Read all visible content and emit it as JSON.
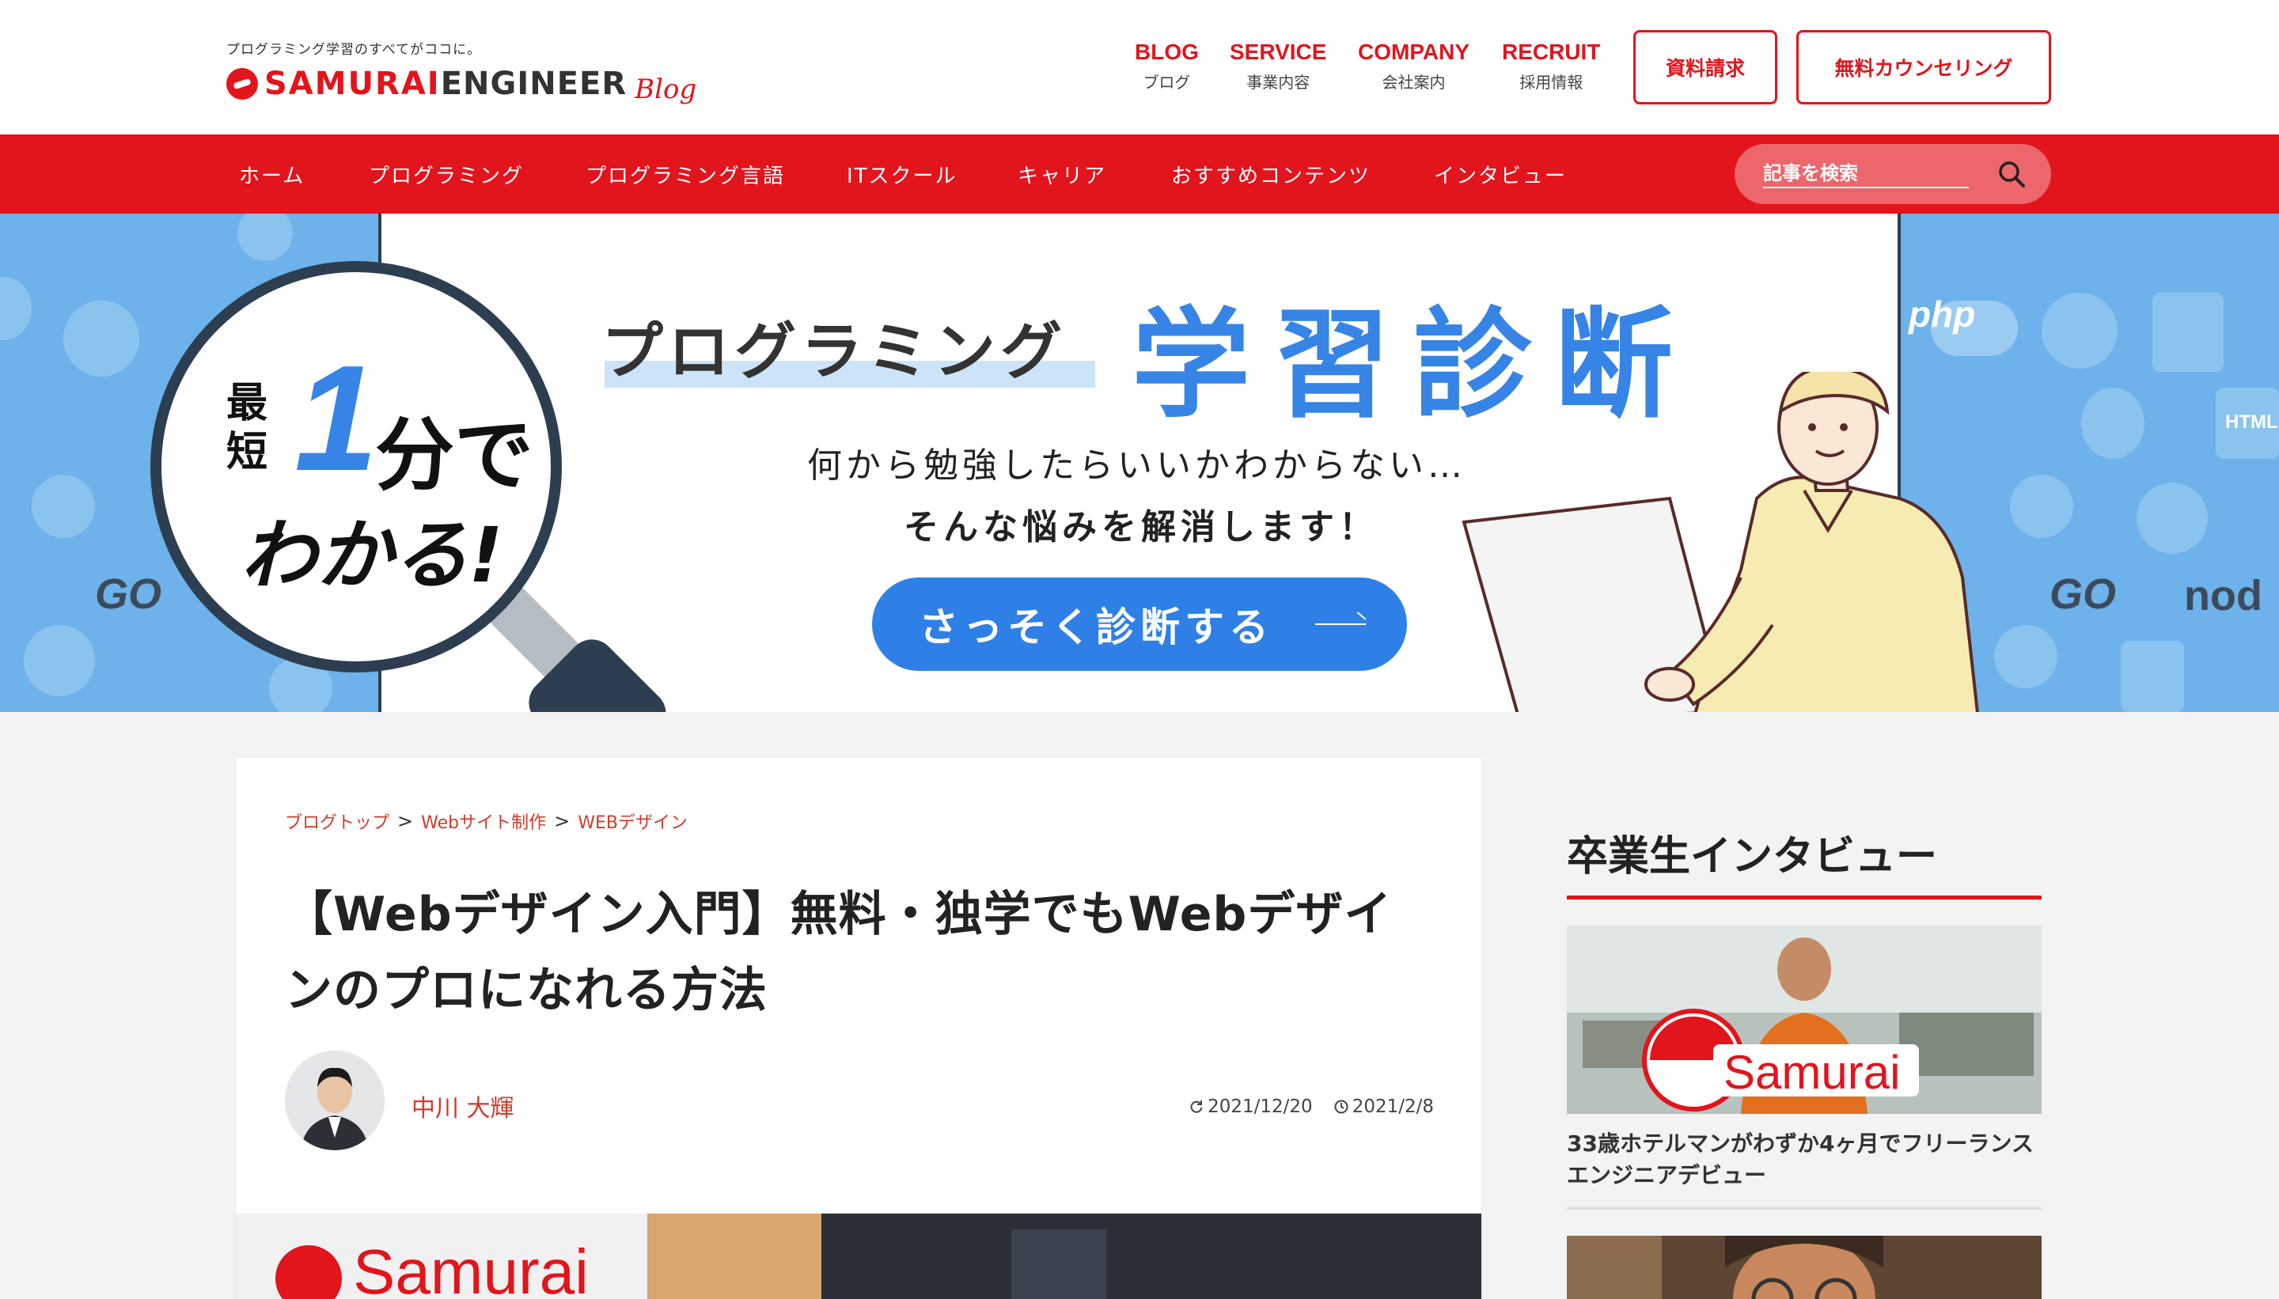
{
  "header": {
    "tagline": "プログラミング学習のすべてがココに。",
    "logo_samurai": "SAMURAI",
    "logo_engineer": "ENGINEER",
    "logo_blog": "Blog",
    "nav": [
      {
        "en": "BLOG",
        "jp": "ブログ"
      },
      {
        "en": "SERVICE",
        "jp": "事業内容"
      },
      {
        "en": "COMPANY",
        "jp": "会社案内"
      },
      {
        "en": "RECRUIT",
        "jp": "採用情報"
      }
    ],
    "request_button": "資料請求",
    "counseling_button": "無料カウンセリング"
  },
  "navbar": {
    "items": [
      "ホーム",
      "プログラミング",
      "プログラミング言語",
      "ITスクール",
      "キャリア",
      "おすすめコンテンツ",
      "インタビュー"
    ],
    "search_placeholder": "記事を検索"
  },
  "banner": {
    "saitan": "最短",
    "one": "1",
    "fun_de": "分で",
    "wakaru": "わかる!",
    "programming": "プログラミング",
    "shindan": "学習診断",
    "sub1": "何から勉強したらいいかわからない…",
    "sub2": "そんな悩みを解消します！",
    "cta": "さっそく診断する",
    "icon_labels": [
      "php",
      "GO",
      "HTML",
      "nod"
    ]
  },
  "article": {
    "breadcrumbs": [
      "ブログトップ",
      "Webサイト制作",
      "WEBデザイン"
    ],
    "separator": ">",
    "title": "【Webデザイン入門】無料・独学でもWebデザインのプロになれる方法",
    "author": "中川 大輝",
    "updated": "2021/12/20",
    "published": "2021/2/8",
    "eyecatch_logo": "Samurai"
  },
  "sidebar": {
    "title": "卒業生インタビュー",
    "card1_caption": "33歳ホテルマンがわずか4ヶ月でフリーランスエンジニアデビュー",
    "card1_sign": "Samurai"
  },
  "colors": {
    "brand_red": "#e2141c",
    "accent_blue": "#3684e6",
    "banner_bg": "#6db2ea"
  }
}
